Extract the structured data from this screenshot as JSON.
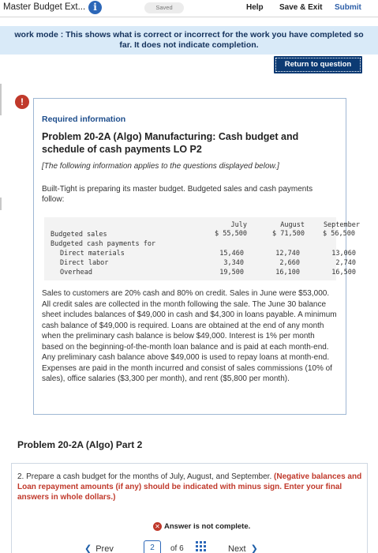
{
  "header": {
    "title": "Master Budget Ext...",
    "saved": "Saved",
    "help": "Help",
    "save_exit": "Save & Exit",
    "submit": "Submit"
  },
  "banner": {
    "text": "work mode : This shows what is correct or incorrect for the work you have completed so far. It does not indicate completion."
  },
  "return_button": "Return to question",
  "card": {
    "required_info": "Required information",
    "title": "Problem 20-2A (Algo) Manufacturing: Cash budget and schedule of cash payments LO P2",
    "note": "[The following information applies to the questions displayed below.]",
    "intro": "Built-Tight is preparing its master budget. Budgeted sales and cash payments follow:",
    "table": {
      "columns": [
        "July",
        "August",
        "September"
      ],
      "rows": [
        {
          "label": "Budgeted sales",
          "values": [
            "$ 55,500",
            "$ 71,500",
            "$ 56,500"
          ]
        },
        {
          "label": "Budgeted cash payments for",
          "values": [
            "",
            "",
            ""
          ]
        },
        {
          "label": "Direct materials",
          "values": [
            "15,460",
            "12,740",
            "13,060"
          ]
        },
        {
          "label": "Direct labor",
          "values": [
            "3,340",
            "2,660",
            "2,740"
          ]
        },
        {
          "label": "Overhead",
          "values": [
            "19,500",
            "16,100",
            "16,500"
          ]
        }
      ]
    },
    "paragraph": "Sales to customers are 20% cash and 80% on credit. Sales in June were $53,000. All credit sales are collected in the month following the sale. The June 30 balance sheet includes balances of $49,000 in cash and $4,300 in loans payable. A minimum cash balance of $49,000 is required. Loans are obtained at the end of any month when the preliminary cash balance is below $49,000. Interest is 1% per month based on the beginning-of-the-month loan balance and is paid at each month-end. Any preliminary cash balance above $49,000 is used to repay loans at month-end. Expenses are paid in the month incurred and consist of sales commissions (10% of sales), office salaries ($3,300 per month), and rent ($5,800 per month)."
  },
  "part_title": "Problem 20-2A (Algo) Part 2",
  "question": {
    "text": "2. Prepare a cash budget for the months of July, August, and September.",
    "instruction": "(Negative balances and Loan repayment amounts (if any) should be indicated with minus sign. Enter your final answers in whole dollars.)",
    "status": "Answer is not complete."
  },
  "nav": {
    "prev": "Prev",
    "page": "2",
    "of": "of 6",
    "next": "Next"
  },
  "colors": {
    "accent": "#2c67b8",
    "button_dark": "#0c3a73",
    "banner_bg": "#d9eaf8",
    "error": "#c0392b"
  },
  "icons": {
    "info": "info-icon",
    "alert": "alert-icon",
    "status": "x-circle-icon",
    "grid": "grid-icon"
  }
}
